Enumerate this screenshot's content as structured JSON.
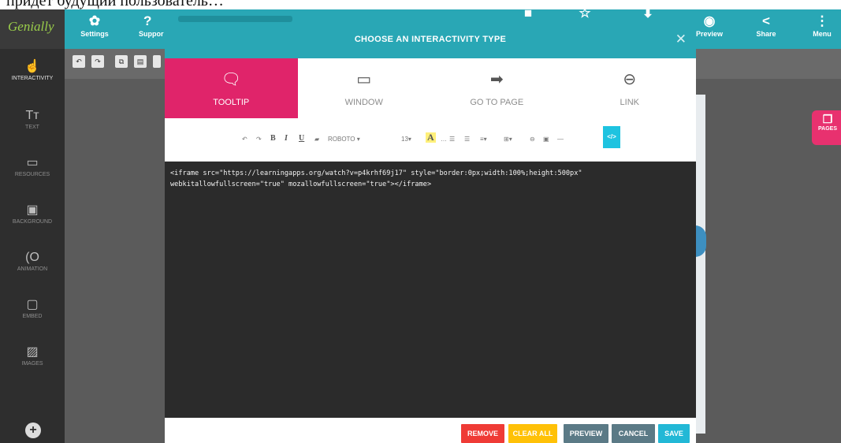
{
  "document_line": "придёт будущий пользователь…",
  "app": {
    "logo": "Genially",
    "topbar": {
      "settings_label": "Settings",
      "support_label": "Suppor",
      "preview_label": "Preview",
      "share_label": "Share",
      "menu_label": "Menu"
    },
    "sidebar": [
      {
        "label": "INTERACTIVITY",
        "icon": "hand-pointer-icon"
      },
      {
        "label": "TEXT",
        "icon": "text-icon"
      },
      {
        "label": "RESOURCES",
        "icon": "resources-icon"
      },
      {
        "label": "BACKGROUND",
        "icon": "background-icon"
      },
      {
        "label": "ANIMATION",
        "icon": "animation-icon"
      },
      {
        "label": "EMBED",
        "icon": "embed-icon"
      },
      {
        "label": "IMAGES",
        "icon": "images-icon"
      }
    ],
    "pages_label": "PAGES",
    "colors": {
      "teal": "#29a7b5",
      "pink": "#e0246a",
      "dark": "#2b2b2b"
    }
  },
  "modal": {
    "title": "CHOOSE AN INTERACTIVITY TYPE",
    "close_glyph": "✕",
    "types": [
      {
        "label": "TOOLTIP",
        "icon": "tooltip-icon",
        "active": true
      },
      {
        "label": "WINDOW",
        "icon": "window-icon",
        "active": false
      },
      {
        "label": "GO TO PAGE",
        "icon": "arrow-right-icon",
        "active": false
      },
      {
        "label": "LINK",
        "icon": "link-icon",
        "active": false
      }
    ],
    "format_toolbar": {
      "font": "ROBOTO ▾",
      "size": "13▾",
      "code_toggle": "</>"
    },
    "code": "<iframe src=\"https://learningapps.org/watch?v=p4krhf69j17\" style=\"border:0px;width:100%;height:500px\" webkitallowfullscreen=\"true\" mozallowfullscreen=\"true\"></iframe>",
    "buttons": {
      "remove": "REMOVE",
      "clear_all": "CLEAR ALL",
      "preview": "PREVIEW",
      "cancel": "CANCEL",
      "save": "SAVE"
    }
  }
}
